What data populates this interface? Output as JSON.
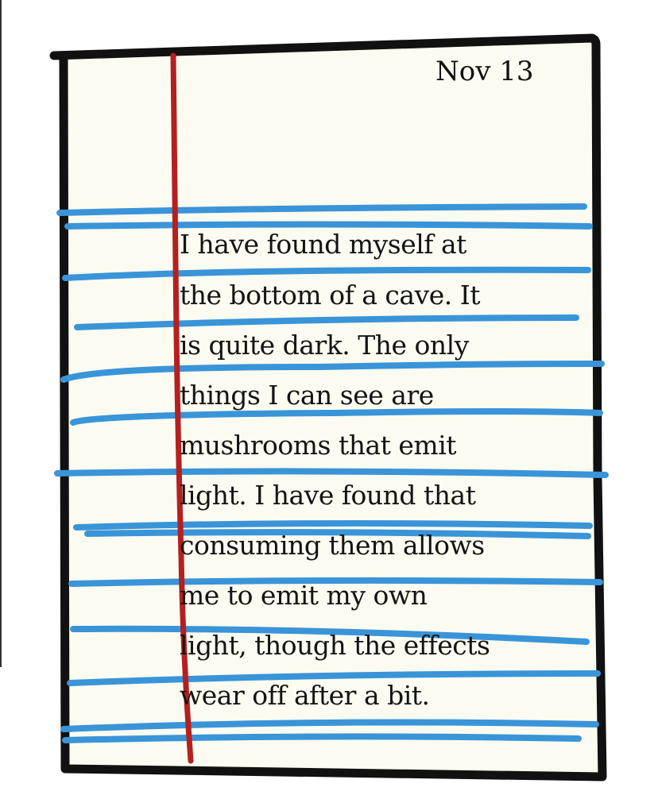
{
  "page": {
    "date": "Nov 13"
  },
  "journal": {
    "lines": [
      "I have found myself at",
      "the bottom of a cave. It",
      "is quite dark. The only",
      "things I can see are",
      "mushrooms that emit",
      "light. I have found that",
      "consuming them allows",
      "me to emit my own",
      "light, though the effects",
      "wear off after a bit."
    ]
  },
  "colors": {
    "paper": "#fbfbf1",
    "border": "#111111",
    "rule_lines": "#3a94d8",
    "margin_line": "#b42020"
  }
}
